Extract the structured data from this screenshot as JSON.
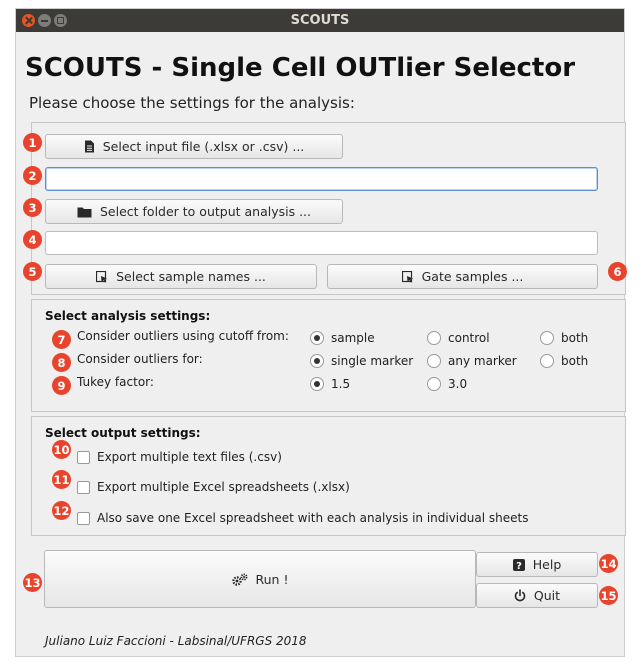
{
  "window": {
    "title": "SCOUTS"
  },
  "header": {
    "title": "SCOUTS - Single Cell OUTlier Selector",
    "subtitle": "Please choose the settings for the analysis:"
  },
  "files": {
    "input_button": "Select input file (.xlsx or .csv) ...",
    "input_value": "",
    "output_button": "Select folder to output analysis ...",
    "output_value": "",
    "samples_button": "Select sample names ...",
    "gate_button": "Gate samples ..."
  },
  "analysis": {
    "heading": "Select analysis settings:",
    "cutoff_label": "Consider outliers using cutoff from:",
    "cutoff_options": [
      "sample",
      "control",
      "both"
    ],
    "cutoff_selected": "sample",
    "outliers_for_label": "Consider outliers for:",
    "outliers_for_options": [
      "single marker",
      "any marker",
      "both"
    ],
    "outliers_for_selected": "single marker",
    "tukey_label": "Tukey factor:",
    "tukey_options": [
      "1.5",
      "3.0"
    ],
    "tukey_selected": "1.5"
  },
  "output": {
    "heading": "Select output settings:",
    "csv_label": "Export multiple text files (.csv)",
    "csv_checked": false,
    "xlsx_label": "Export multiple Excel spreadsheets (.xlsx)",
    "xlsx_checked": false,
    "single_label": "Also save one Excel spreadsheet with each analysis in individual sheets",
    "single_checked": false
  },
  "actions": {
    "run": "Run !",
    "help": "Help",
    "quit": "Quit"
  },
  "footer": "Juliano Luiz Faccioni - Labsinal/UFRGS 2018",
  "badges": [
    "1",
    "2",
    "3",
    "4",
    "5",
    "6",
    "7",
    "8",
    "9",
    "10",
    "11",
    "12",
    "13",
    "14",
    "15"
  ],
  "colors": {
    "badge": "#e8442d",
    "titlebar": "#3c3b37",
    "close": "#e95420",
    "focus": "#5c8fd0"
  }
}
